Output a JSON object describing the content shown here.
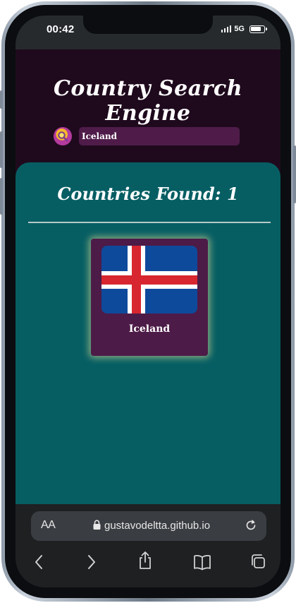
{
  "status_bar": {
    "time": "00:42",
    "network": "5G"
  },
  "header": {
    "title": "Country Search Engine"
  },
  "search": {
    "value": "Iceland",
    "icon": "search-magnifier-icon"
  },
  "results": {
    "title": "Countries Found: 1",
    "countries": [
      {
        "name": "Iceland",
        "flag": "iceland-flag",
        "flag_colors": {
          "field": "#0e4a9c",
          "border_cross": "#ffffff",
          "cross": "#d7262f"
        }
      }
    ]
  },
  "browser": {
    "aa_label": "AA",
    "url": "gustavodeltta.github.io",
    "nav": [
      "back-icon",
      "forward-icon",
      "share-icon",
      "bookmarks-icon",
      "tabs-icon"
    ]
  },
  "colors": {
    "header_bg": "#1f0a1d",
    "results_bg": "#065e63",
    "card_bg": "#4d1b47",
    "input_bg": "#4f1c4a"
  }
}
